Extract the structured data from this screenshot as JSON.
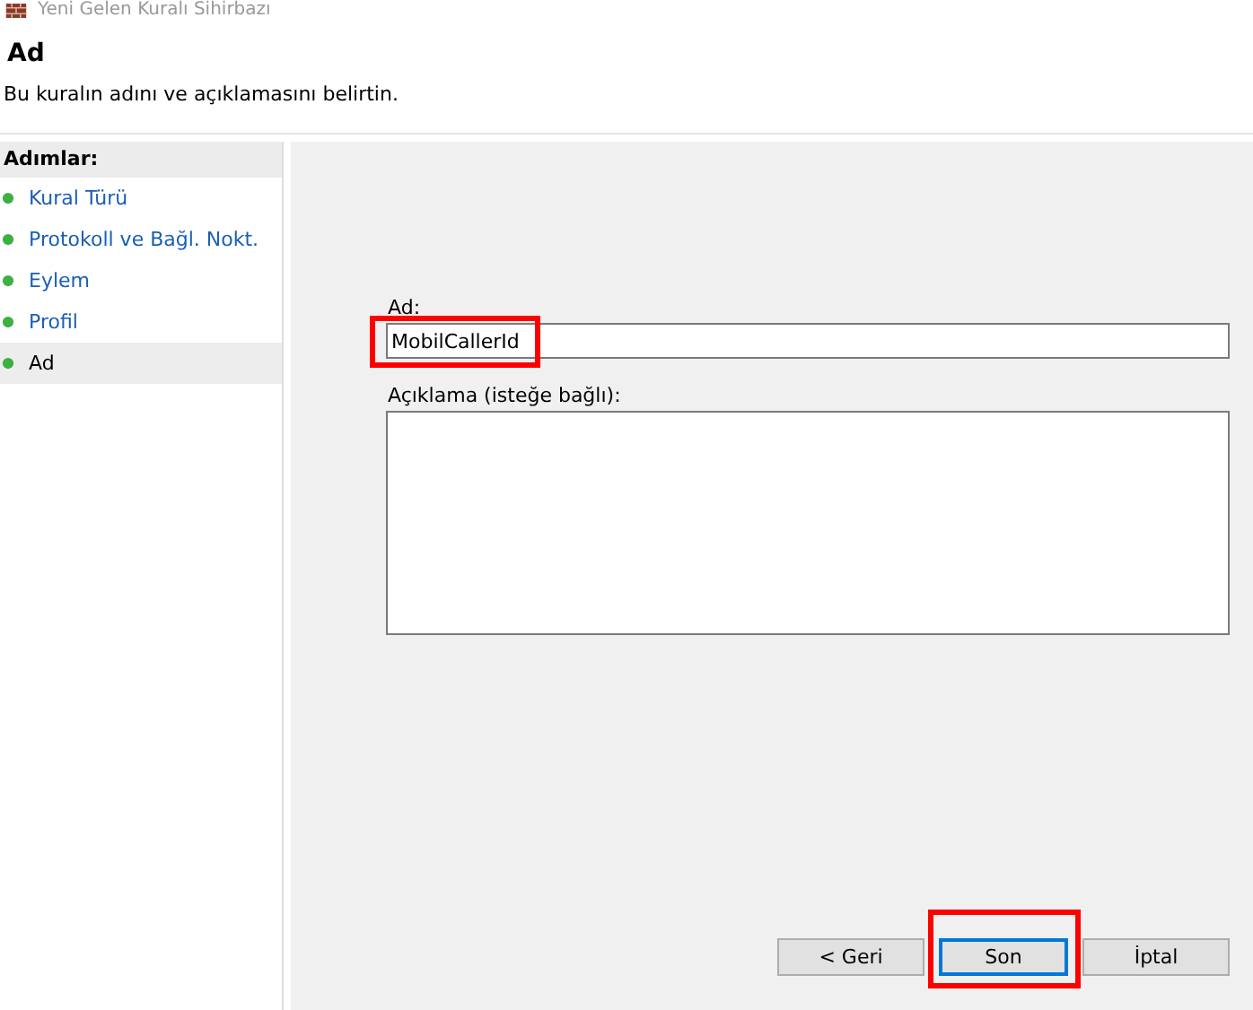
{
  "window": {
    "title": "Yeni Gelen Kuralı Sihirbazı"
  },
  "header": {
    "title": "Ad",
    "subtitle": "Bu kuralın adını ve açıklamasını belirtin."
  },
  "steps": {
    "heading": "Adımlar:",
    "items": [
      {
        "label": "Kural Türü",
        "selected": false
      },
      {
        "label": "Protokoll ve Bağl. Nokt.",
        "selected": false
      },
      {
        "label": "Eylem",
        "selected": false
      },
      {
        "label": "Profil",
        "selected": false
      },
      {
        "label": "Ad",
        "selected": true
      }
    ]
  },
  "form": {
    "name_label": "Ad:",
    "name_value": "MobilCallerId",
    "name_highlighted": true,
    "description_label": "Açıklama (isteğe bağlı):"
  },
  "buttons": [
    {
      "label": "< Geri",
      "default": false,
      "highlighted": false
    },
    {
      "label": "Son",
      "default": true,
      "highlighted": true
    },
    {
      "label": "İptal",
      "default": false,
      "highlighted": false
    }
  ]
}
